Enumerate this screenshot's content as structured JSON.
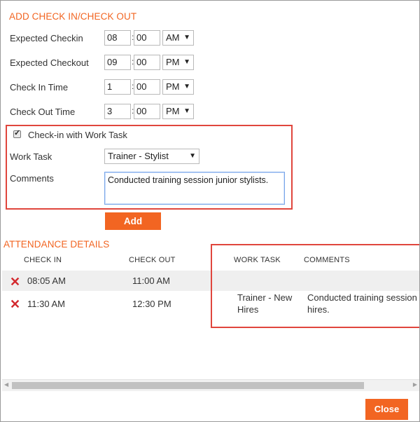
{
  "form": {
    "title": "ADD CHECK IN/CHECK OUT",
    "rows": [
      {
        "label": "Expected Checkin",
        "hour": "08",
        "minute": "00",
        "ampm": "AM"
      },
      {
        "label": "Expected Checkout",
        "hour": "09",
        "minute": "00",
        "ampm": "PM"
      },
      {
        "label": "Check In Time",
        "hour": "1",
        "minute": "00",
        "ampm": "PM"
      },
      {
        "label": "Check Out Time",
        "hour": "3",
        "minute": "00",
        "ampm": "PM"
      }
    ],
    "checkin_with_work_task_label": "Check-in with Work Task",
    "checkin_with_work_task_checked": true,
    "work_task_label": "Work Task",
    "work_task_value": "Trainer - Stylist",
    "comments_label": "Comments",
    "comments_value": "Conducted training session junior stylists.",
    "add_button": "Add"
  },
  "attendance": {
    "title": "ATTENDANCE DETAILS",
    "headers": {
      "check_in": "CHECK IN",
      "check_out": "CHECK OUT",
      "work_task": "WORK TASK",
      "comments": "COMMENTS"
    },
    "rows": [
      {
        "check_in": "08:05 AM",
        "check_out": "11:00 AM",
        "work_task_line1": "",
        "work_task_line2": "",
        "comments_line1": "",
        "comments_line2": ""
      },
      {
        "check_in": "11:30 AM",
        "check_out": "12:30 PM",
        "work_task_line1": "Trainer - New",
        "work_task_line2": "Hires",
        "comments_line1": "Conducted training session",
        "comments_line2": "hires."
      }
    ]
  },
  "footer": {
    "close_button": "Close"
  },
  "colors": {
    "accent": "#f26522",
    "highlight_border": "#e0463d",
    "delete_icon": "#d3282d"
  },
  "icons": {
    "delete": "x-icon",
    "dropdown": "caret-down-icon",
    "scroll_left": "arrow-left-icon",
    "scroll_right": "arrow-right-icon"
  }
}
